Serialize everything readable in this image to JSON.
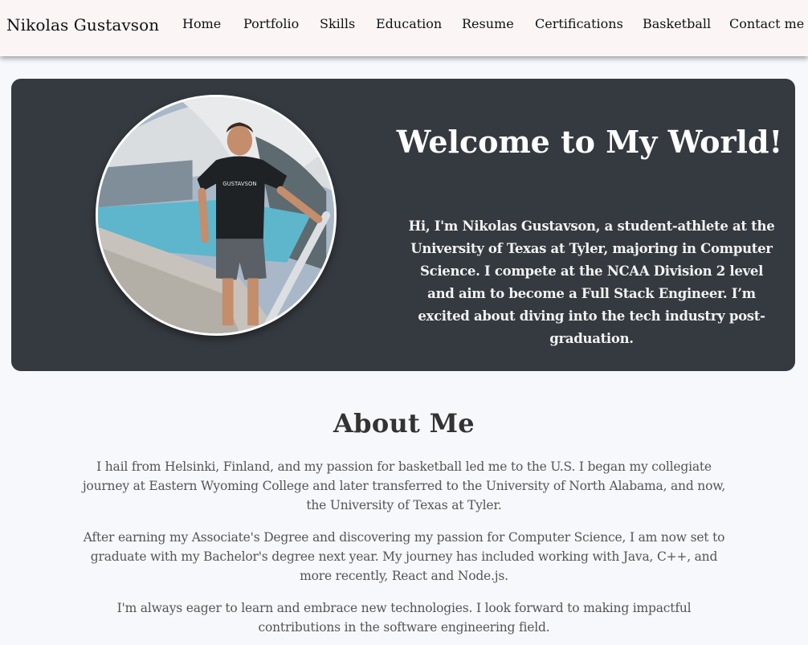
{
  "nav": {
    "brand": "Nikolas Gustavson",
    "links": [
      "Home",
      "Portfolio",
      "Skills",
      "Education",
      "Resume",
      "Certifications",
      "Basketball",
      "Contact me"
    ]
  },
  "hero": {
    "title": "Welcome to My World!",
    "text": "Hi, I'm Nikolas Gustavson, a student-athlete at the University of Texas at Tyler, majoring in Computer Science. I compete at the NCAA Division 2 level and aim to become a Full Stack Engineer. I’m excited about diving into the tech industry post-graduation.",
    "shirt_text": "GUSTAVSON",
    "colors": {
      "background": "#353a40",
      "text": "#ffffff"
    }
  },
  "about": {
    "title": "About Me",
    "paragraphs": [
      "I hail from Helsinki, Finland, and my passion for basketball led me to the U.S. I began my collegiate journey at Eastern Wyoming College and later transferred to the University of North Alabama, and now, the University of Texas at Tyler.",
      "After earning my Associate's Degree and discovering my passion for Computer Science, I am now set to graduate with my Bachelor's degree next year. My journey has included working with Java, C++, and more recently, React and Node.js.",
      "I'm always eager to learn and embrace new technologies. I look forward to making impactful contributions in the software engineering field."
    ]
  }
}
